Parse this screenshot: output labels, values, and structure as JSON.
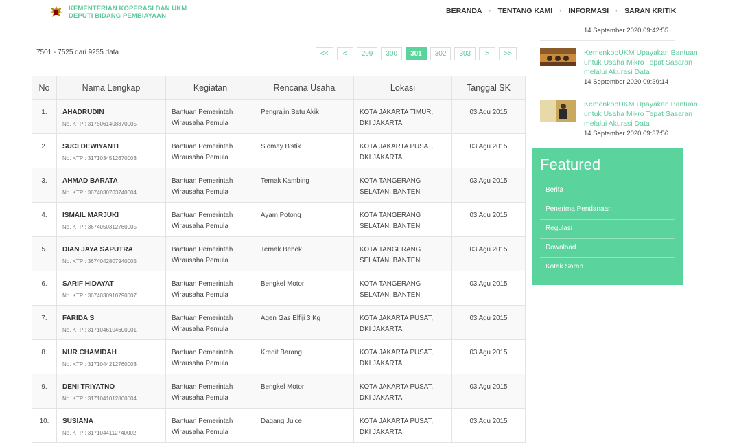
{
  "header": {
    "logo_line1": "KEMENTERIAN KOPERASI DAN UKM",
    "logo_line2": "DEPUTI BIDANG PEMBIAYAAN",
    "nav": [
      "BERANDA",
      "TENTANG KAMI",
      "INFORMASI",
      "SARAN KRITIK"
    ],
    "nav_separator": "·"
  },
  "info_text": "7501 - 7525 dari 9255 data",
  "pagination": [
    "<<",
    "<",
    "299",
    "300",
    "301",
    "302",
    "303",
    ">",
    ">>"
  ],
  "pagination_active": "301",
  "table": {
    "headers": [
      "No",
      "Nama Lengkap",
      "Kegiatan",
      "Rencana Usaha",
      "Lokasi",
      "Tanggal SK"
    ],
    "rows": [
      {
        "no": "1.",
        "name": "AHADRUDIN",
        "ktp": "No. KTP : 3175061408870005",
        "kegiatan1": "Bantuan Pemerintah",
        "kegiatan2": "Wirausaha Pemula",
        "usaha": "Pengrajin Batu Akik",
        "lokasi1": "KOTA JAKARTA TIMUR,",
        "lokasi2": "DKI JAKARTA",
        "tanggal": "03 Agu 2015"
      },
      {
        "no": "2.",
        "name": "SUCI DEWIYANTI",
        "ktp": "No. KTP : 3171034512670003",
        "kegiatan1": "Bantuan Pemerintah",
        "kegiatan2": "Wirausaha Pemula",
        "usaha": "Siomay B'stik",
        "lokasi1": "KOTA JAKARTA PUSAT,",
        "lokasi2": "DKI JAKARTA",
        "tanggal": "03 Agu 2015"
      },
      {
        "no": "3.",
        "name": "AHMAD BARATA",
        "ktp": "No. KTP : 3674030703740004",
        "kegiatan1": "Bantuan Pemerintah",
        "kegiatan2": "Wirausaha Pemula",
        "usaha": "Ternak Kambing",
        "lokasi1": "KOTA TANGERANG",
        "lokasi2": "SELATAN, BANTEN",
        "tanggal": "03 Agu 2015"
      },
      {
        "no": "4.",
        "name": "ISMAIL MARJUKI",
        "ktp": "No. KTP : 3674050312760005",
        "kegiatan1": "Bantuan Pemerintah",
        "kegiatan2": "Wirausaha Pemula",
        "usaha": "Ayam Potong",
        "lokasi1": "KOTA TANGERANG",
        "lokasi2": "SELATAN, BANTEN",
        "tanggal": "03 Agu 2015"
      },
      {
        "no": "5.",
        "name": "DIAN JAYA SAPUTRA",
        "ktp": "No. KTP : 3674042807940005",
        "kegiatan1": "Bantuan Pemerintah",
        "kegiatan2": "Wirausaha Pemula",
        "usaha": "Ternak Bebek",
        "lokasi1": "KOTA TANGERANG",
        "lokasi2": "SELATAN, BANTEN",
        "tanggal": "03 Agu 2015"
      },
      {
        "no": "6.",
        "name": "SARIF HIDAYAT",
        "ktp": "No. KTP : 3674030910790007",
        "kegiatan1": "Bantuan Pemerintah",
        "kegiatan2": "Wirausaha Pemula",
        "usaha": "Bengkel Motor",
        "lokasi1": "KOTA TANGERANG",
        "lokasi2": "SELATAN, BANTEN",
        "tanggal": "03 Agu 2015"
      },
      {
        "no": "7.",
        "name": "FARIDA S",
        "ktp": "No. KTP : 3171046104600001",
        "kegiatan1": "Bantuan Pemerintah",
        "kegiatan2": "Wirausaha Pemula",
        "usaha": "Agen Gas Elfiji 3 Kg",
        "lokasi1": "KOTA JAKARTA PUSAT,",
        "lokasi2": "DKI JAKARTA",
        "tanggal": "03 Agu 2015"
      },
      {
        "no": "8.",
        "name": "NUR CHAMIDAH",
        "ktp": "No. KTP : 3171044212760003",
        "kegiatan1": "Bantuan Pemerintah",
        "kegiatan2": "Wirausaha Pemula",
        "usaha": "Kredit Barang",
        "lokasi1": "KOTA JAKARTA PUSAT,",
        "lokasi2": "DKI JAKARTA",
        "tanggal": "03 Agu 2015"
      },
      {
        "no": "9.",
        "name": "DENI TRIYATNO",
        "ktp": "No. KTP : 3171041012860004",
        "kegiatan1": "Bantuan Pemerintah",
        "kegiatan2": "Wirausaha Pemula",
        "usaha": "Bengkel Motor",
        "lokasi1": "KOTA JAKARTA PUSAT,",
        "lokasi2": "DKI JAKARTA",
        "tanggal": "03 Agu 2015"
      },
      {
        "no": "10.",
        "name": "SUSIANA",
        "ktp": "No. KTP : 3171044112740002",
        "kegiatan1": "Bantuan Pemerintah",
        "kegiatan2": "Wirausaha Pemula",
        "usaha": "Dagang Juice",
        "lokasi1": "KOTA JAKARTA PUSAT,",
        "lokasi2": "DKI JAKARTA",
        "tanggal": "03 Agu 2015"
      }
    ]
  },
  "sidebar": {
    "top_date": "14 September 2020 09:42:55",
    "news": [
      {
        "title": "KemenkopUKM Upayakan Bantuan untuk Usaha Mikro Tepat Sasaran melalui Akurasi Data",
        "date": "14 September 2020 09:39:14"
      },
      {
        "title": "KemenkopUKM Upayakan Bantuan untuk Usaha Mikro Tepat Sasaran melalui Akurasi Data",
        "date": "14 September 2020 09:37:56"
      }
    ],
    "featured_title": "Featured",
    "featured_links": [
      "Berita",
      "Penerima Pendanaan",
      "Regulasi",
      "Download",
      "Kotak Saran"
    ]
  },
  "colors": {
    "accent": "#5bd39c",
    "link": "#5bc99a"
  }
}
